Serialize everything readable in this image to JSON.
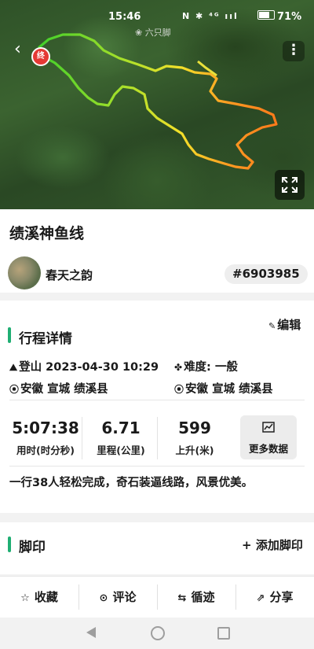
{
  "status_bar": {
    "time": "15:46",
    "icons": "N ✱ ⁴ᴳ ııl",
    "battery": "71%"
  },
  "map": {
    "watermark": "六只脚",
    "end_marker": "终"
  },
  "route": {
    "title": "绩溪神鱼线",
    "author": "春天之韵",
    "id": "#6903985"
  },
  "details": {
    "section_title": "行程详情",
    "edit_label": "编辑",
    "activity": "登山",
    "datetime": "2023-04-30 10:29",
    "difficulty_label": "难度:",
    "difficulty_value": "一般",
    "start_location": "安徽 宣城 绩溪县",
    "end_location": "安徽 宣城 绩溪县",
    "stats": [
      {
        "value": "5:07:38",
        "label": "用时(时分秒)"
      },
      {
        "value": "6.71",
        "label": "里程(公里)"
      },
      {
        "value": "599",
        "label": "上升(米)"
      }
    ],
    "more_data_label": "更多数据",
    "description": "一行38人轻松完成，奇石装逼线路，风景优美。"
  },
  "footprint": {
    "section_title": "脚印",
    "add_label": "添加脚印"
  },
  "bottom_bar": {
    "favorite": "收藏",
    "comment": "评论",
    "follow_track": "循迹",
    "share": "分享"
  },
  "colors": {
    "accent": "#1fae73",
    "track_start": "#2ecc40",
    "track_end": "#ff8c1a",
    "end_marker": "#e53935"
  }
}
